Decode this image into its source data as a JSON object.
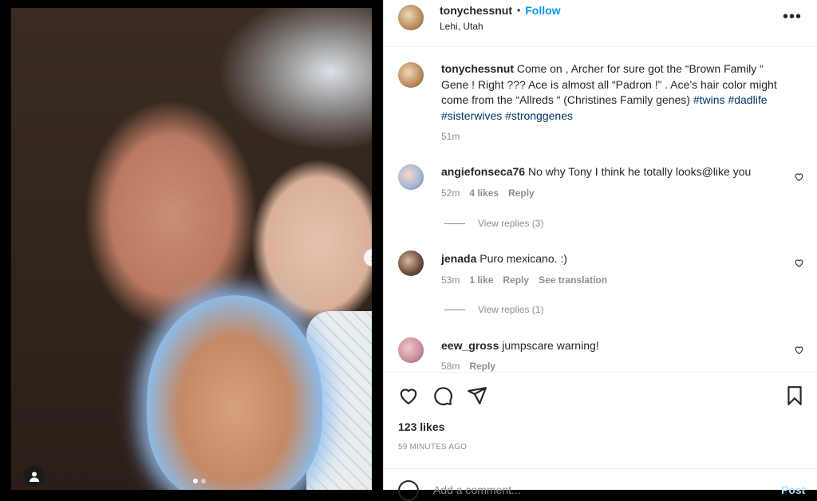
{
  "post": {
    "username": "tonychessnut",
    "follow_label": "Follow",
    "bullet": "•",
    "location": "Lehi, Utah",
    "more_icon": "ellipsis-icon"
  },
  "caption": {
    "username": "tonychessnut",
    "text": "Come on , Archer for sure got the “Brown Family “ Gene ! Right ??? Ace is almost all “Padron !” . Ace’s hair color might come from the “Allreds “ (Christines Family genes)",
    "hashtags": [
      "#twins",
      "#dadlife",
      "#sisterwives",
      "#stronggenes"
    ],
    "time": "51m"
  },
  "comments": [
    {
      "username": "angiefonseca76",
      "text": "No why Tony I think he totally looks@like you",
      "time": "52m",
      "likes": "4 likes",
      "reply": "Reply",
      "view_replies": "View replies (3)"
    },
    {
      "username": "jenada",
      "text": "Puro mexicano. :)",
      "time": "53m",
      "likes": "1 like",
      "reply": "Reply",
      "translation": "See translation",
      "view_replies": "View replies (1)"
    },
    {
      "username": "eew_gross",
      "text": "jumpscare warning!",
      "time": "58m",
      "reply": "Reply"
    }
  ],
  "footer": {
    "likes": "123 likes",
    "time_ago": "59 MINUTES AGO",
    "comment_placeholder": "Add a comment...",
    "post_label": "Post"
  },
  "media": {
    "next_arrow": "›",
    "carousel_count": 2,
    "carousel_active": 1
  },
  "colors": {
    "accent": "#0095f6",
    "hashtag": "#00376b",
    "muted": "#8e8e8e"
  }
}
